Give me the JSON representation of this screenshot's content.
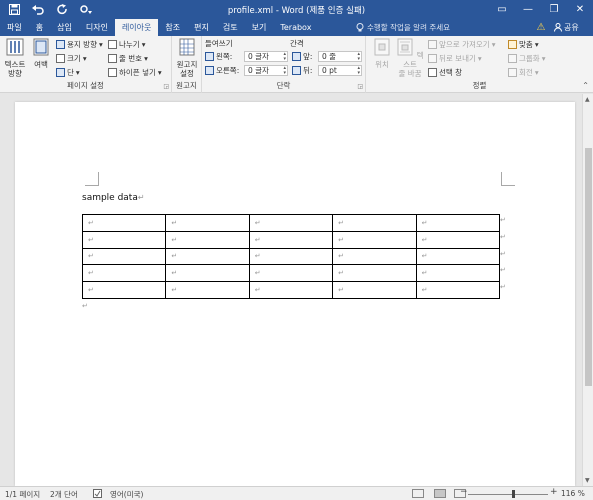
{
  "window": {
    "title": "profile.xml - Word (제품 인증 실패)",
    "minimize_glyph": "—",
    "restore_glyph": "❐",
    "close_glyph": "✕",
    "ribbon_options_glyph": "▭"
  },
  "qat": {
    "save_icon": "save-icon",
    "undo_icon": "undo-icon",
    "redo_icon": "redo-icon",
    "customize_icon": "customize-icon"
  },
  "tabs": [
    {
      "label": "파일",
      "active": false
    },
    {
      "label": "홈",
      "active": false
    },
    {
      "label": "삽입",
      "active": false
    },
    {
      "label": "디자인",
      "active": false
    },
    {
      "label": "레이아웃",
      "active": true
    },
    {
      "label": "참조",
      "active": false
    },
    {
      "label": "편지",
      "active": false
    },
    {
      "label": "검토",
      "active": false
    },
    {
      "label": "보기",
      "active": false
    },
    {
      "label": "Terabox",
      "active": false
    }
  ],
  "tellme": "수행할 작업을 알려 주세요",
  "share_label": "공유",
  "ribbon": {
    "page_setup": {
      "label": "페이지 설정",
      "text_direction": "텍스트\n방향",
      "margins": "여백",
      "orientation": "용지 방향",
      "size": "크기",
      "columns": "단",
      "breaks": "나누기",
      "line_numbers": "줄 번호",
      "hyphenation": "하이픈 넣기"
    },
    "paper": {
      "label": "원고지",
      "button": "원고지\n설정"
    },
    "paragraph": {
      "label": "단락",
      "indent_heading": "들여쓰기",
      "spacing_heading": "간격",
      "left_label": "왼쪽:",
      "right_label": "오른쪽:",
      "before_label": "앞:",
      "after_label": "뒤:",
      "left_value": "0 글자",
      "right_value": "0 글자",
      "before_value": "0 줄",
      "after_value": "0 pt"
    },
    "arrange": {
      "label": "정렬",
      "position": "위치",
      "wrap_text": "텍스트\n줄 바꿈",
      "bring_forward": "앞으로 가져오기",
      "send_backward": "뒤로 보내기",
      "selection_pane": "선택 창",
      "align": "맞춤",
      "group": "그룹화",
      "rotate": "회전"
    }
  },
  "document": {
    "first_line": "sample data",
    "pilcrow": "↵",
    "cell_mark": "↵",
    "table": {
      "rows": 5,
      "cols": 5
    }
  },
  "status": {
    "page": "1/1 페이지",
    "words": "2개 단어",
    "language": "영어(미국)",
    "zoom_minus": "−",
    "zoom_plus": "+",
    "zoom": "116 %"
  }
}
